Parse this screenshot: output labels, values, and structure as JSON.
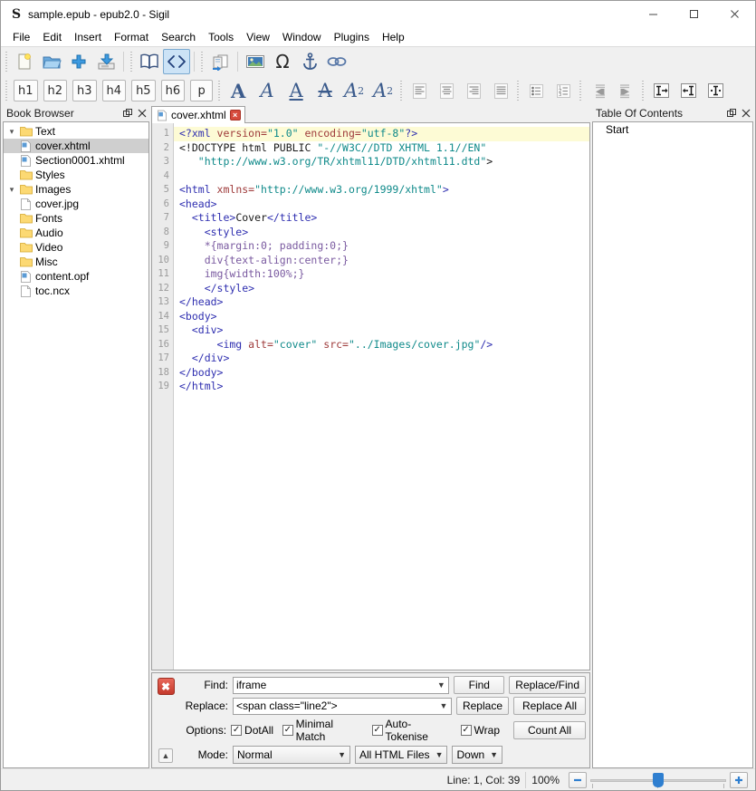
{
  "window": {
    "title": "sample.epub - epub2.0 - Sigil",
    "logo": "S",
    "minimize": "minimize-icon",
    "maximize": "maximize-icon",
    "close": "close-icon"
  },
  "menubar": {
    "items": [
      "File",
      "Edit",
      "Insert",
      "Format",
      "Search",
      "Tools",
      "View",
      "Window",
      "Plugins",
      "Help"
    ]
  },
  "toolbar_row1": [
    {
      "name": "new-file-button",
      "icon": "new-document-icon"
    },
    {
      "name": "open-file-button",
      "icon": "open-folder-icon"
    },
    {
      "name": "add-file-button",
      "icon": "plus-icon"
    },
    {
      "name": "save-button",
      "icon": "save-disk-icon"
    },
    {
      "name": "book-view-button",
      "icon": "book-icon"
    },
    {
      "name": "code-view-button",
      "icon": "code-brackets-icon",
      "active": true
    },
    {
      "name": "split-file-button",
      "icon": "split-marker-icon"
    },
    {
      "name": "insert-image-button",
      "icon": "image-icon"
    },
    {
      "name": "insert-special-character-button",
      "icon": "omega-icon"
    },
    {
      "name": "insert-id-button",
      "icon": "anchor-icon"
    },
    {
      "name": "insert-link-button",
      "icon": "chain-link-icon"
    }
  ],
  "toolbar_headings": [
    "h1",
    "h2",
    "h3",
    "h4",
    "h5",
    "h6",
    "p"
  ],
  "toolbar_format": [
    {
      "name": "bold-button",
      "glyph": "A",
      "style": "bold"
    },
    {
      "name": "italic-button",
      "glyph": "A",
      "style": "ital"
    },
    {
      "name": "underline-button",
      "glyph": "A",
      "style": "und"
    },
    {
      "name": "strikethrough-button",
      "glyph": "A",
      "style": "strk"
    },
    {
      "name": "subscript-button",
      "glyph": "A",
      "style": "sub",
      "affix": "2"
    },
    {
      "name": "superscript-button",
      "glyph": "A",
      "style": "sup",
      "affix": "2"
    }
  ],
  "toolbar_align": [
    {
      "name": "align-left-button",
      "icon": "align-left-icon"
    },
    {
      "name": "align-center-button",
      "icon": "align-center-icon"
    },
    {
      "name": "align-right-button",
      "icon": "align-right-icon"
    },
    {
      "name": "align-justify-button",
      "icon": "align-justify-icon"
    },
    {
      "name": "bullet-list-button",
      "icon": "bullet-list-icon"
    },
    {
      "name": "numbered-list-button",
      "icon": "numbered-list-icon"
    },
    {
      "name": "decrease-indent-button",
      "icon": "outdent-icon"
    },
    {
      "name": "increase-indent-button",
      "icon": "indent-icon"
    },
    {
      "name": "text-direction-ltr-button",
      "icon": "text-direction-ltr-icon"
    },
    {
      "name": "text-direction-rtl-button",
      "icon": "text-direction-rtl-icon"
    },
    {
      "name": "text-direction-auto-button",
      "icon": "text-direction-auto-icon"
    }
  ],
  "book_browser": {
    "title": "Book Browser",
    "float_button": "undock-icon",
    "close_button": "close-icon",
    "items": [
      {
        "label": "Text",
        "type": "folder",
        "indent": 0,
        "twisty": "expanded"
      },
      {
        "label": "cover.xhtml",
        "type": "xhtml",
        "indent": 1,
        "selected": true
      },
      {
        "label": "Section0001.xhtml",
        "type": "xhtml",
        "indent": 1
      },
      {
        "label": "Styles",
        "type": "folder",
        "indent": 0
      },
      {
        "label": "Images",
        "type": "folder",
        "indent": 0,
        "twisty": "expanded"
      },
      {
        "label": "cover.jpg",
        "type": "file",
        "indent": 1
      },
      {
        "label": "Fonts",
        "type": "folder",
        "indent": 0
      },
      {
        "label": "Audio",
        "type": "folder",
        "indent": 0
      },
      {
        "label": "Video",
        "type": "folder",
        "indent": 0
      },
      {
        "label": "Misc",
        "type": "folder",
        "indent": 0
      },
      {
        "label": "content.opf",
        "type": "xhtml",
        "indent": 0
      },
      {
        "label": "toc.ncx",
        "type": "file",
        "indent": 0
      }
    ]
  },
  "editor": {
    "tab": {
      "label": "cover.xhtml",
      "icon": "xhtml-file-icon",
      "close": "×"
    },
    "current_line": 1,
    "lines": [
      {
        "n": 1,
        "segments": [
          {
            "t": "<?xml ",
            "c": "tg"
          },
          {
            "t": "version=",
            "c": "at"
          },
          {
            "t": "\"1.0\"",
            "c": "vl"
          },
          {
            "t": " encoding=",
            "c": "at"
          },
          {
            "t": "\"utf-8\"",
            "c": "vl"
          },
          {
            "t": "?>",
            "c": "tg"
          }
        ]
      },
      {
        "n": 2,
        "segments": [
          {
            "t": "<!DOCTYPE html PUBLIC ",
            "c": "tx"
          },
          {
            "t": "\"-//W3C//DTD XHTML 1.1//EN\"",
            "c": "vl"
          }
        ]
      },
      {
        "n": 3,
        "segments": [
          {
            "t": "   ",
            "c": "tx"
          },
          {
            "t": "\"http://www.w3.org/TR/xhtml11/DTD/xhtml11.dtd\"",
            "c": "vl"
          },
          {
            "t": ">",
            "c": "tx"
          }
        ]
      },
      {
        "n": 4,
        "segments": []
      },
      {
        "n": 5,
        "segments": [
          {
            "t": "<html ",
            "c": "tg"
          },
          {
            "t": "xmlns=",
            "c": "at"
          },
          {
            "t": "\"http://www.w3.org/1999/xhtml\"",
            "c": "vl"
          },
          {
            "t": ">",
            "c": "tg"
          }
        ]
      },
      {
        "n": 6,
        "segments": [
          {
            "t": "<head>",
            "c": "tg"
          }
        ]
      },
      {
        "n": 7,
        "segments": [
          {
            "t": "  <title>",
            "c": "tg"
          },
          {
            "t": "Cover",
            "c": "tx"
          },
          {
            "t": "</title>",
            "c": "tg"
          }
        ]
      },
      {
        "n": 8,
        "segments": [
          {
            "t": "    <style>",
            "c": "tg"
          }
        ]
      },
      {
        "n": 9,
        "segments": [
          {
            "t": "    *{margin:0; padding:0;}",
            "c": "cs"
          }
        ]
      },
      {
        "n": 10,
        "segments": [
          {
            "t": "    div{text-align:center;}",
            "c": "cs"
          }
        ]
      },
      {
        "n": 11,
        "segments": [
          {
            "t": "    img{width:100%;}",
            "c": "cs"
          }
        ]
      },
      {
        "n": 12,
        "segments": [
          {
            "t": "    </style>",
            "c": "tg"
          }
        ]
      },
      {
        "n": 13,
        "segments": [
          {
            "t": "</head>",
            "c": "tg"
          }
        ]
      },
      {
        "n": 14,
        "segments": [
          {
            "t": "<body>",
            "c": "tg"
          }
        ]
      },
      {
        "n": 15,
        "segments": [
          {
            "t": "  <div>",
            "c": "tg"
          }
        ]
      },
      {
        "n": 16,
        "segments": [
          {
            "t": "      <img ",
            "c": "tg"
          },
          {
            "t": "alt=",
            "c": "at"
          },
          {
            "t": "\"cover\"",
            "c": "vl"
          },
          {
            "t": " src=",
            "c": "at"
          },
          {
            "t": "\"../Images/cover.jpg\"",
            "c": "vl"
          },
          {
            "t": "/>",
            "c": "tg"
          }
        ]
      },
      {
        "n": 17,
        "segments": [
          {
            "t": "  </div>",
            "c": "tg"
          }
        ]
      },
      {
        "n": 18,
        "segments": [
          {
            "t": "</body>",
            "c": "tg"
          }
        ]
      },
      {
        "n": 19,
        "segments": [
          {
            "t": "</html>",
            "c": "tg"
          }
        ]
      }
    ]
  },
  "toc": {
    "title": "Table Of Contents",
    "float_button": "undock-icon",
    "close_button": "close-icon",
    "items": [
      "Start"
    ]
  },
  "find_replace": {
    "close_icon": "close-x-icon",
    "collapse_icon": "chevron-up-icon",
    "find_label": "Find:",
    "find_value": "iframe",
    "find_placeholder": "",
    "replace_label": "Replace:",
    "replace_value": "<span class=\"line2\">",
    "replace_placeholder": "",
    "options_label": "Options:",
    "options": [
      {
        "label": "DotAll",
        "checked": true
      },
      {
        "label": "Minimal Match",
        "checked": true
      },
      {
        "label": "Auto-Tokenise",
        "checked": true
      },
      {
        "label": "Wrap",
        "checked": true
      }
    ],
    "mode_label": "Mode:",
    "mode_value": "Normal",
    "scope_value": "All HTML Files",
    "direction_value": "Down",
    "buttons": {
      "find": "Find",
      "replace_find": "Replace/Find",
      "replace": "Replace",
      "replace_all": "Replace All",
      "count_all": "Count All"
    }
  },
  "statusbar": {
    "position": "Line: 1, Col: 39",
    "zoom": "100%",
    "zoom_out_icon": "minus-icon",
    "zoom_in_icon": "plus-icon",
    "slider_value": 50
  }
}
